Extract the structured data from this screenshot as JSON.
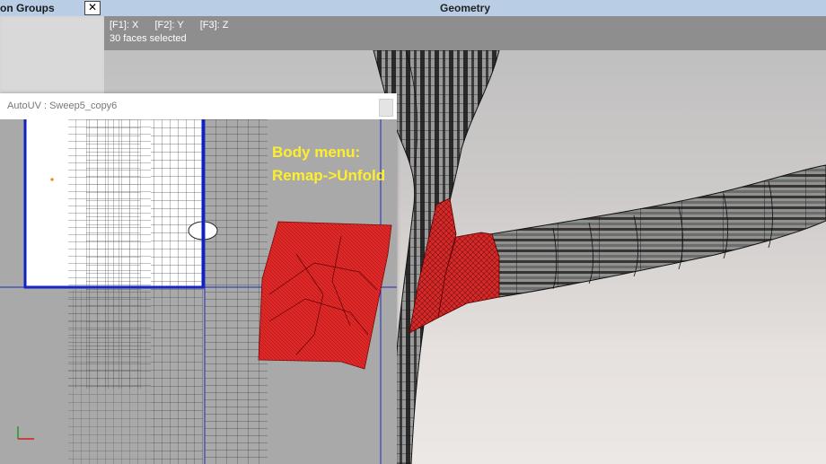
{
  "groups_panel": {
    "title": "on Groups",
    "close_glyph": "✕"
  },
  "geometry_panel": {
    "title": "Geometry",
    "axis_keys": [
      "[F1]: X",
      "[F2]: Y",
      "[F3]: Z"
    ],
    "selection_status": "30 faces selected"
  },
  "autouv_window": {
    "title": "AutoUV : Sweep5_copy6",
    "annotation_line1": "Body menu:",
    "annotation_line2": "Remap->Unfold"
  },
  "colors": {
    "panel_title_bg": "#b9cde4",
    "selection_red": "#d42a2a",
    "uv_bg": "#a9a9a9",
    "annotation_yellow": "#ffef2a",
    "uv_border_blue": "#1020c0"
  },
  "icons": [
    "close-icon",
    "axis-gizmo-icon"
  ]
}
